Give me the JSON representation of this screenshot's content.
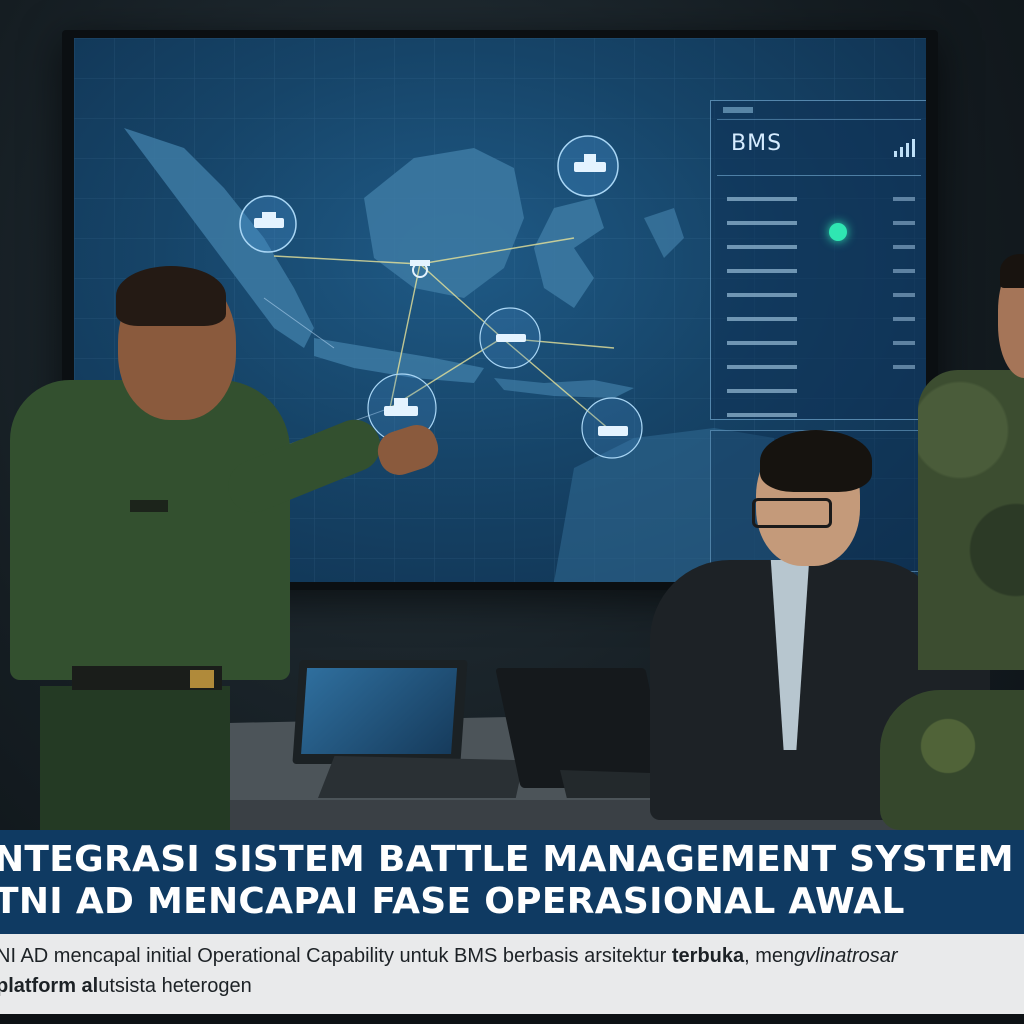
{
  "screen": {
    "panel_title": "BMS"
  },
  "banner": {
    "headline_line1": "NTEGRASI SISTEM BATTLE MANAGEMENT SYSTEM (BMS)",
    "headline_line2": "TNI AD MENCAPAI FASE OPERASIONAL AWAL",
    "subtitle_line1_a": "NI AD mencapal initial Operational Capability untuk BMS berbasis arsitektur ",
    "subtitle_line1_b": "terbuka",
    "subtitle_line1_c": ", men",
    "subtitle_line1_d": "gvlinatrosar",
    "subtitle_line2_a": "platform al",
    "subtitle_line2_b": "utsista heterogen"
  },
  "colors": {
    "banner": "#0f3a62",
    "subtitle_bg": "#e9eaeb",
    "map_land": "#3d7aa3",
    "status_dot": "#2fe6b2"
  }
}
